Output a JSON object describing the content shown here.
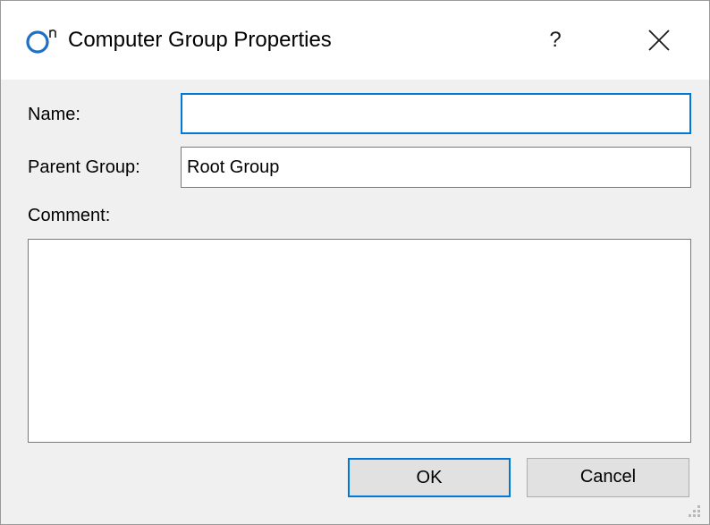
{
  "window": {
    "title": "Computer Group Properties",
    "help_label": "?"
  },
  "icons": {
    "app": "app-logo-icon",
    "close": "close-icon",
    "grip": "resize-grip-icon"
  },
  "form": {
    "name_label": "Name:",
    "name_value": "",
    "parent_group_label": "Parent Group:",
    "parent_group_value": "Root Group",
    "comment_label": "Comment:",
    "comment_value": ""
  },
  "buttons": {
    "ok_label": "OK",
    "cancel_label": "Cancel"
  },
  "colors": {
    "accent": "#0078d7",
    "window_bg": "#f0f0f0",
    "titlebar_bg": "#ffffff"
  }
}
